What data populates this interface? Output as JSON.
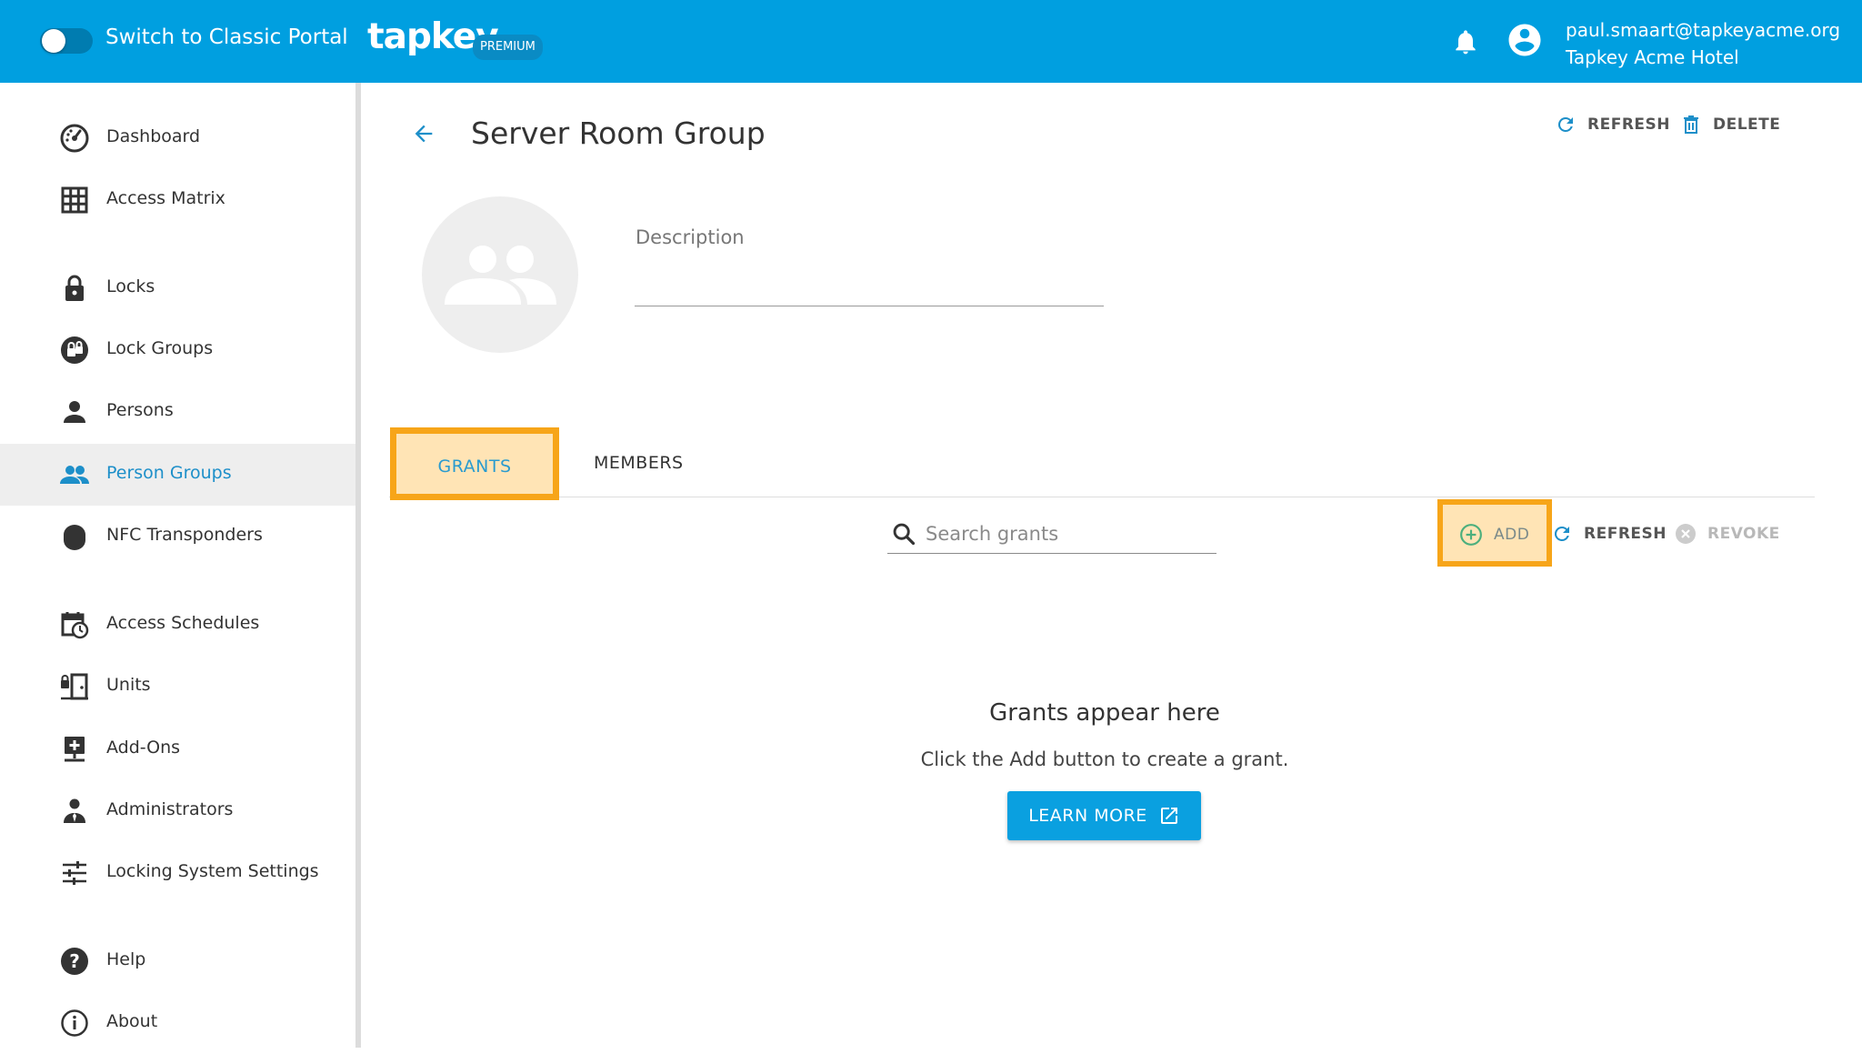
{
  "header": {
    "switch_label": "Switch to Classic Portal",
    "logo": "tapkey",
    "badge": "PREMIUM",
    "user_email": "paul.smaart@tapkeyacme.org",
    "user_org": "Tapkey Acme Hotel"
  },
  "sidebar": {
    "items": [
      {
        "label": "Dashboard",
        "icon": "dashboard-icon"
      },
      {
        "label": "Access Matrix",
        "icon": "grid-icon"
      },
      {
        "label": "Locks",
        "icon": "lock-icon"
      },
      {
        "label": "Lock Groups",
        "icon": "lock-group-icon"
      },
      {
        "label": "Persons",
        "icon": "person-icon"
      },
      {
        "label": "Person Groups",
        "icon": "people-icon",
        "active": true
      },
      {
        "label": "NFC Transponders",
        "icon": "transponder-icon"
      },
      {
        "label": "Access Schedules",
        "icon": "schedule-icon"
      },
      {
        "label": "Units",
        "icon": "units-icon"
      },
      {
        "label": "Add-Ons",
        "icon": "add-ons-icon"
      },
      {
        "label": "Administrators",
        "icon": "administrator-icon"
      },
      {
        "label": "Locking System Settings",
        "icon": "settings-sliders-icon"
      },
      {
        "label": "Help",
        "icon": "help-icon"
      },
      {
        "label": "About",
        "icon": "info-icon"
      }
    ]
  },
  "page": {
    "title": "Server Room Group",
    "refresh_label": "REFRESH",
    "delete_label": "DELETE",
    "description_label": "Description"
  },
  "tabs": [
    {
      "label": "GRANTS",
      "active": true
    },
    {
      "label": "MEMBERS",
      "active": false
    }
  ],
  "grants_toolbar": {
    "search_placeholder": "Search grants",
    "add_label": "ADD",
    "refresh_label": "REFRESH",
    "revoke_label": "REVOKE"
  },
  "empty_state": {
    "title": "Grants appear here",
    "subtitle": "Click the Add button to create a grant.",
    "button_label": "LEARN MORE"
  },
  "colors": {
    "brand_blue": "#009fe0",
    "accent_blue": "#1d8fc9",
    "highlight_orange": "#f7a519",
    "highlight_fill": "#ffe4b5"
  }
}
